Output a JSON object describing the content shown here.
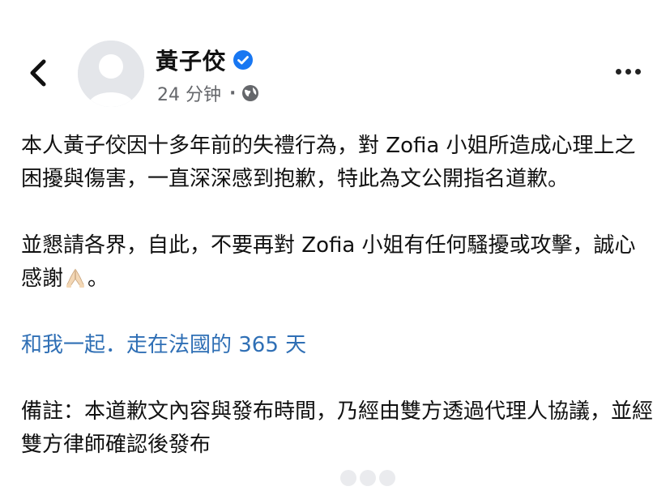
{
  "header": {
    "author_name": "黃子佼",
    "verified_icon": "verified-badge-icon",
    "timestamp": "24 分钟",
    "separator": "·",
    "audience_icon": "globe-icon",
    "more_icon": "more-horizontal-icon",
    "back_icon": "chevron-left-icon"
  },
  "post": {
    "paragraph1": "本人黃子佼因十多年前的失禮行為，對 Zofia 小姐所造成心理上之困擾與傷害，一直深深感到抱歉，特此為文公開指名道歉。",
    "paragraph2_text": "並懇請各界，自此，不要再對 Zofia 小姐有任何騷擾或攻擊，誠心感謝",
    "paragraph2_emoji": "folded-hands-emoji",
    "paragraph2_end": "。",
    "link_text": "和我一起．走在法國的 365 天",
    "note": "備註：本道歉文內容與發布時間，乃經由雙方透過代理人協議，並經雙方律師確認後發布"
  },
  "colors": {
    "link": "#2f6fb5",
    "meta": "#65676b",
    "verified": "#1877f2",
    "text": "#111111"
  }
}
